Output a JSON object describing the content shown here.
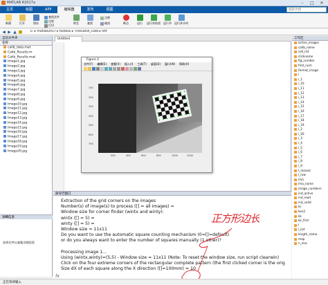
{
  "window": {
    "title": "MATLAB R2017a"
  },
  "tabs": [
    {
      "label": "主页",
      "active": false
    },
    {
      "label": "绘图",
      "active": false
    },
    {
      "label": "APP",
      "active": false
    },
    {
      "label": "编辑器",
      "active": true
    },
    {
      "label": "发布",
      "active": false
    },
    {
      "label": "视图",
      "active": false
    }
  ],
  "search": {
    "placeholder": "搜索文档"
  },
  "ribbon": {
    "new": "新建",
    "open": "打开",
    "save": "保存",
    "find_files": "查找文件",
    "compare": "比较",
    "print": "打印",
    "goto": "转至",
    "find": "查找",
    "comment": "注释",
    "indent": "缩进",
    "breakpoint": "断点",
    "run": "运行",
    "run_section": "运行节",
    "run_advance": "运行并前进",
    "run_time": "运行并计时"
  },
  "address": {
    "path": "E: ▸ matlab2017 ▸ toolbox ▸ TOOLBOX_calib ▸ left"
  },
  "left_panel": {
    "header": "当前文件夹",
    "column": "名称",
    "files": [
      {
        "name": "calib_data.mat",
        "kind": "m"
      },
      {
        "name": "Calib_Results.m",
        "kind": "m"
      },
      {
        "name": "Calib_Results.mat",
        "kind": "m"
      },
      {
        "name": "Image1.jpg",
        "kind": "j"
      },
      {
        "name": "Image2.jpg",
        "kind": "j"
      },
      {
        "name": "Image3.jpg",
        "kind": "j"
      },
      {
        "name": "Image4.jpg",
        "kind": "j"
      },
      {
        "name": "Image5.jpg",
        "kind": "j"
      },
      {
        "name": "Image6.jpg",
        "kind": "j"
      },
      {
        "name": "Image7.jpg",
        "kind": "j"
      },
      {
        "name": "Image8.jpg",
        "kind": "j"
      },
      {
        "name": "Image9.jpg",
        "kind": "j"
      },
      {
        "name": "Image10.jpg",
        "kind": "j"
      },
      {
        "name": "Image11.jpg",
        "kind": "j"
      },
      {
        "name": "Image12.jpg",
        "kind": "j"
      },
      {
        "name": "Image13.jpg",
        "kind": "j"
      },
      {
        "name": "Image14.jpg",
        "kind": "j"
      },
      {
        "name": "Image15.jpg",
        "kind": "j"
      },
      {
        "name": "Image16.jpg",
        "kind": "j"
      },
      {
        "name": "Image17.jpg",
        "kind": "j"
      },
      {
        "name": "Image18.jpg",
        "kind": "j"
      },
      {
        "name": "Image19.jpg",
        "kind": "j"
      },
      {
        "name": "Image20.jpg",
        "kind": "j"
      }
    ],
    "details_header": "详细信息",
    "details_message": "选择文件以查看详细信息"
  },
  "editor": {
    "header": "编辑器 - Untitled",
    "tab": "Untitled"
  },
  "figure": {
    "title": "Figure 2",
    "menu": [
      "文件(F)",
      "编辑(E)",
      "查看(V)",
      "插入(I)",
      "工具(T)",
      "桌面(D)",
      "窗口(W)",
      "帮助(H)"
    ],
    "yticks": [
      "100",
      "200",
      "300",
      "400",
      "500",
      "600",
      "700"
    ],
    "xticks": [
      "200",
      "400",
      "600",
      "800",
      "1000",
      "1200"
    ]
  },
  "command": {
    "header": "命令行窗口",
    "lines": [
      "Extraction of the grid corners on the images",
      "Number(s) of image(s) to process ([] = all images) =",
      "Window size for corner finder (wintx and winty):",
      "wintx ([] = 5) =",
      "winty ([] = 5) =",
      "Window size = 11x11",
      "Do you want to use the automatic square counting mechanism (0=[]=default)",
      "  or do you always want to enter the number of squares manually (1,other)?",
      "",
      "Processing image 1...",
      "Using (wintx,winty)=(5,5) - Window size = 11x11     (Note: To reset the window size, run script clearwin)",
      "Click on the four extreme corners of the rectangular complete pattern (the first clicked corner is the orig",
      "Size dX of each square along the X direction ([]=100mm) = 10"
    ],
    "prompt": "fx"
  },
  "workspace": {
    "header": "工作区",
    "items": [
      "active_images",
      "calib_name",
      "cell_list",
      "clickname",
      "fig_number",
      "first_num",
      "format_image",
      "i",
      "i_1",
      "i_10",
      "i_11",
      "i_12",
      "i_13",
      "i_14",
      "i_15",
      "i_16",
      "i_17",
      "i_18",
      "i_19",
      "i_2",
      "i_20",
      "i_3",
      "i_4",
      "i_5",
      "i_6",
      "i_7",
      "i_8",
      "i_9",
      "I_mosaic",
      "i_row",
      "ima",
      "ima_name",
      "image_numbers",
      "ind_active",
      "ind_read",
      "ind_valid",
      "kc",
      "ken2",
      "kk",
      "kk_first",
      "l",
      "l_list",
      "length_name",
      "map",
      "n_ima"
    ]
  },
  "status": {
    "text": "正在等待输入"
  },
  "annotation": {
    "text": "正方形边长",
    "color": "#e0262c"
  }
}
